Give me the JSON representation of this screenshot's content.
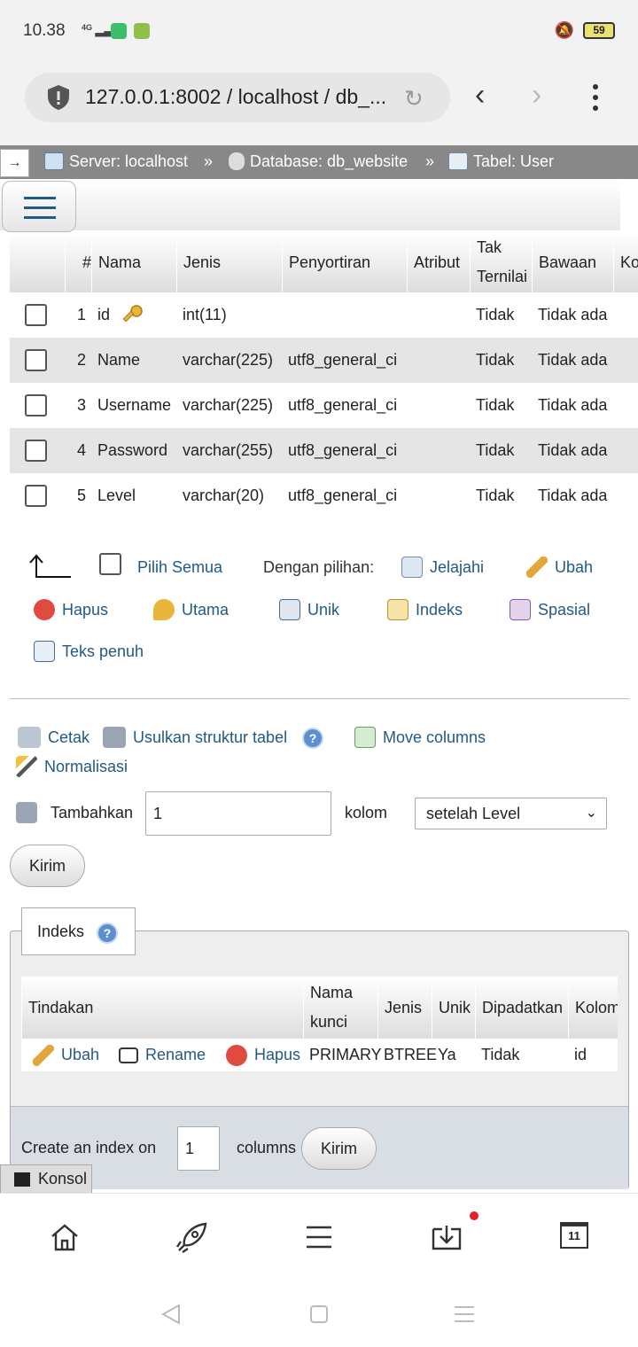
{
  "status": {
    "time": "10.38",
    "network": "4G",
    "battery": "59"
  },
  "browser": {
    "url": "127.0.0.1:8002 / localhost / db_..."
  },
  "breadcrumb": {
    "server": "Server: localhost",
    "database": "Database: db_website",
    "table": "Tabel: User",
    "sep": "»"
  },
  "structure": {
    "headers": [
      "#",
      "Nama",
      "Jenis",
      "Penyortiran",
      "Atribut",
      "Tak Ternilai",
      "Bawaan",
      "Ko"
    ],
    "rows": [
      {
        "num": "1",
        "name": "id",
        "type": "int(11)",
        "collation": "",
        "attr": "",
        "null": "Tidak",
        "default": "Tidak ada"
      },
      {
        "num": "2",
        "name": "Name",
        "type": "varchar(225)",
        "collation": "utf8_general_ci",
        "attr": "",
        "null": "Tidak",
        "default": "Tidak ada"
      },
      {
        "num": "3",
        "name": "Username",
        "type": "varchar(225)",
        "collation": "utf8_general_ci",
        "attr": "",
        "null": "Tidak",
        "default": "Tidak ada"
      },
      {
        "num": "4",
        "name": "Password",
        "type": "varchar(255)",
        "collation": "utf8_general_ci",
        "attr": "",
        "null": "Tidak",
        "default": "Tidak ada"
      },
      {
        "num": "5",
        "name": "Level",
        "type": "varchar(20)",
        "collation": "utf8_general_ci",
        "attr": "",
        "null": "Tidak",
        "default": "Tidak ada"
      }
    ]
  },
  "bulk": {
    "select_all": "Pilih Semua",
    "with_selected": "Dengan pilihan:",
    "browse": "Jelajahi",
    "change": "Ubah",
    "drop": "Hapus",
    "primary": "Utama",
    "unique": "Unik",
    "index": "Indeks",
    "spatial": "Spasial",
    "fulltext": "Teks penuh"
  },
  "tools": {
    "print": "Cetak",
    "propose": "Usulkan struktur tabel",
    "move_columns": "Move columns",
    "normalize": "Normalisasi"
  },
  "add_column": {
    "label": "Tambahkan",
    "count": "1",
    "unit": "kolom",
    "position": "setelah Level",
    "submit": "Kirim"
  },
  "indexes": {
    "legend": "Indeks",
    "headers": [
      "Tindakan",
      "Nama kunci",
      "Jenis",
      "Unik",
      "Dipadatkan",
      "Kolom"
    ],
    "row": {
      "edit": "Ubah",
      "rename": "Rename",
      "drop": "Hapus",
      "keyname": "PRIMARY",
      "type": "BTREE",
      "unique": "Ya",
      "packed": "Tidak",
      "column": "id"
    },
    "create_label": "Create an index on",
    "create_count": "1",
    "create_unit": "columns",
    "create_submit": "Kirim"
  },
  "console": "Konsol",
  "tabs_count": "11"
}
